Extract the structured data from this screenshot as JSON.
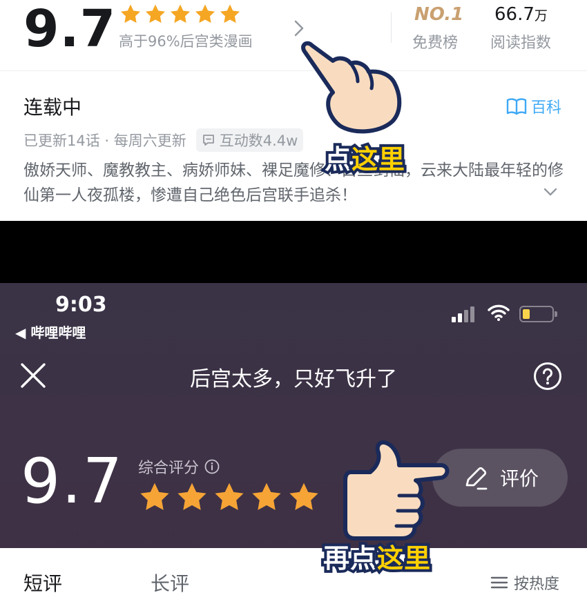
{
  "top": {
    "score": "9.7",
    "stars": 5,
    "above_text": "高于96%后宫类漫画",
    "rank": "NO.1",
    "rank_label": "免费榜",
    "reads_value": "66.7",
    "reads_unit": "万",
    "reads_label": "阅读指数",
    "status": "连载中",
    "wiki_label": "百科",
    "update_text": "已更新14话 · 每周六更新",
    "interact_text": "互动数4.4w",
    "description": "傲娇天师、魔教教主、病娇师妹、裸足魔修、白丝剑仙，云来大陆最年轻的修仙第一人夜孤楼，惨遭自己绝色后宫联手追杀！"
  },
  "bottom": {
    "time": "9:03",
    "back_app": "◀ 哔哩哔哩",
    "title": "后宫太多，只好飞升了",
    "score": "9.7",
    "overall_label": "综合评分",
    "stars": 5,
    "rate_button": "评价",
    "tabs": [
      "短评",
      "长评"
    ],
    "sort_label": "按热度"
  },
  "callouts": {
    "first_white": "点",
    "first_yellow": "这里",
    "second_white": "再点",
    "second_yellow": "这里"
  },
  "colors": {
    "star": "#f5a623",
    "accent_blue": "#3fa9f5",
    "rank_gold": "#c9a070",
    "dark_bg": "#3c3245",
    "callout_yellow": "#ffd000",
    "battery_yellow": "#f7d44c"
  },
  "icons": [
    "star-icon",
    "chevron-right-icon",
    "book-icon",
    "comment-icon",
    "chevron-down-icon",
    "wifi-icon",
    "battery-icon",
    "close-icon",
    "help-icon",
    "info-icon",
    "pencil-icon",
    "sort-icon",
    "pointing-hand-icon"
  ]
}
